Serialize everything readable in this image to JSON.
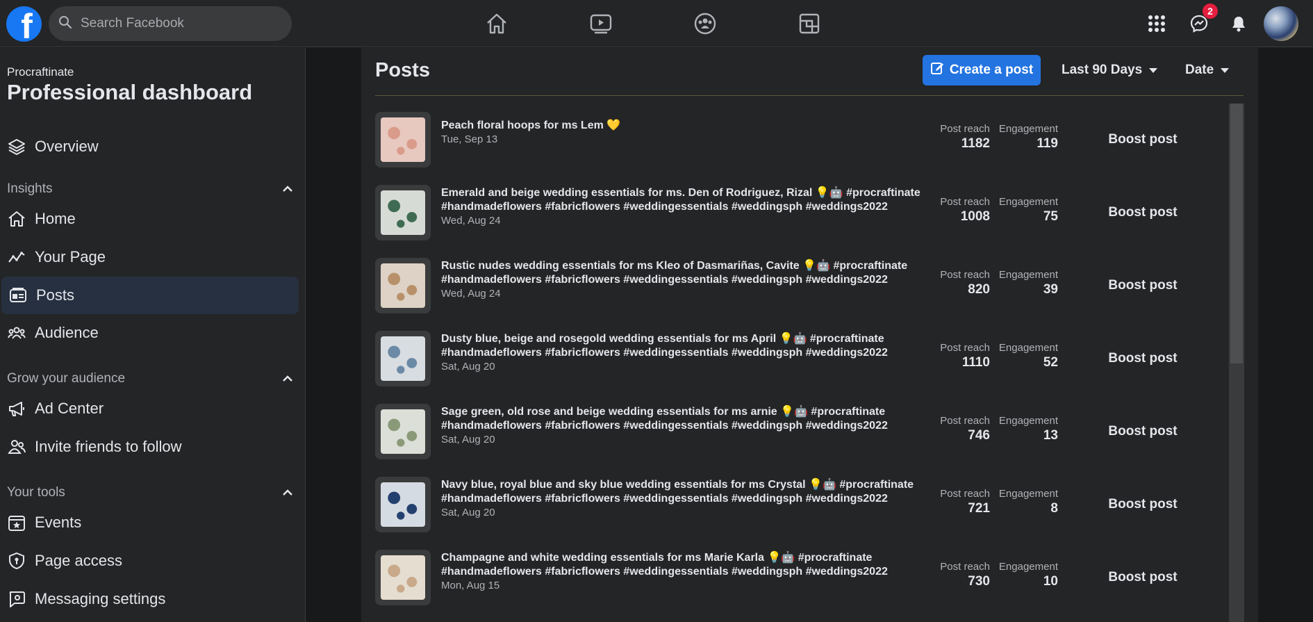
{
  "topbar": {
    "search_placeholder": "Search Facebook",
    "messenger_badge": "2"
  },
  "sidebar": {
    "page_name": "Procraftinate",
    "title": "Professional dashboard",
    "overview": "Overview",
    "sections": {
      "insights": "Insights",
      "grow": "Grow your audience",
      "tools": "Your tools"
    },
    "items": {
      "home": "Home",
      "your_page": "Your Page",
      "posts": "Posts",
      "audience": "Audience",
      "ad_center": "Ad Center",
      "invite": "Invite friends to follow",
      "events": "Events",
      "page_access": "Page access",
      "messaging": "Messaging settings"
    }
  },
  "main": {
    "title": "Posts",
    "create_label": "Create a post",
    "range_filter": "Last 90 Days",
    "sort_filter": "Date",
    "reach_label": "Post reach",
    "engagement_label": "Engagement",
    "boost_label": "Boost post",
    "posts": [
      {
        "line1": "Peach floral hoops for ms Lem 💛",
        "line2": "",
        "date": "Tue, Sep 13",
        "reach": "1182",
        "engagement": "119"
      },
      {
        "line1": "Emerald and beige wedding essentials for ms. Den of Rodriguez, Rizal 💡🤖 #procraftinate",
        "line2": "#handmadeflowers #fabricflowers #weddingessentials #weddingsph #weddings2022",
        "date": "Wed, Aug 24",
        "reach": "1008",
        "engagement": "75"
      },
      {
        "line1": "Rustic nudes wedding essentials for ms Kleo of Dasmariñas, Cavite 💡🤖 #procraftinate",
        "line2": "#handmadeflowers #fabricflowers #weddingessentials #weddingsph #weddings2022",
        "date": "Wed, Aug 24",
        "reach": "820",
        "engagement": "39"
      },
      {
        "line1": "Dusty blue, beige and rosegold wedding essentials for ms April 💡🤖 #procraftinate",
        "line2": "#handmadeflowers #fabricflowers #weddingessentials #weddingsph #weddings2022",
        "date": "Sat, Aug 20",
        "reach": "1110",
        "engagement": "52"
      },
      {
        "line1": "Sage green, old rose and beige wedding essentials for ms arnie 💡🤖 #procraftinate",
        "line2": "#handmadeflowers #fabricflowers #weddingessentials #weddingsph #weddings2022",
        "date": "Sat, Aug 20",
        "reach": "746",
        "engagement": "13"
      },
      {
        "line1": "Navy blue, royal blue and sky blue wedding essentials for ms Crystal 💡🤖 #procraftinate",
        "line2": "#handmadeflowers #fabricflowers #weddingessentials #weddingsph #weddings2022",
        "date": "Sat, Aug 20",
        "reach": "721",
        "engagement": "8"
      },
      {
        "line1": "Champagne and white wedding essentials for ms Marie Karla 💡🤖 #procraftinate",
        "line2": "#handmadeflowers #fabricflowers #weddingessentials #weddingsph #weddings2022",
        "date": "Mon, Aug 15",
        "reach": "730",
        "engagement": "10"
      }
    ]
  },
  "colors": {
    "accent": "#2374e1",
    "brand": "#1877f2",
    "badge": "#e41e3f",
    "active_item": "#263040"
  },
  "icons": [
    "facebook-logo",
    "search-icon",
    "home-icon",
    "watch-icon",
    "groups-icon",
    "gaming-icon",
    "menu-grid-icon",
    "messenger-icon",
    "bell-icon",
    "layers-icon",
    "chevron-up-icon",
    "trend-icon",
    "posts-icon",
    "people-icon",
    "megaphone-icon",
    "add-friend-icon",
    "calendar-star-icon",
    "shield-icon",
    "chat-gear-icon",
    "edit-icon",
    "caret-down-icon"
  ]
}
